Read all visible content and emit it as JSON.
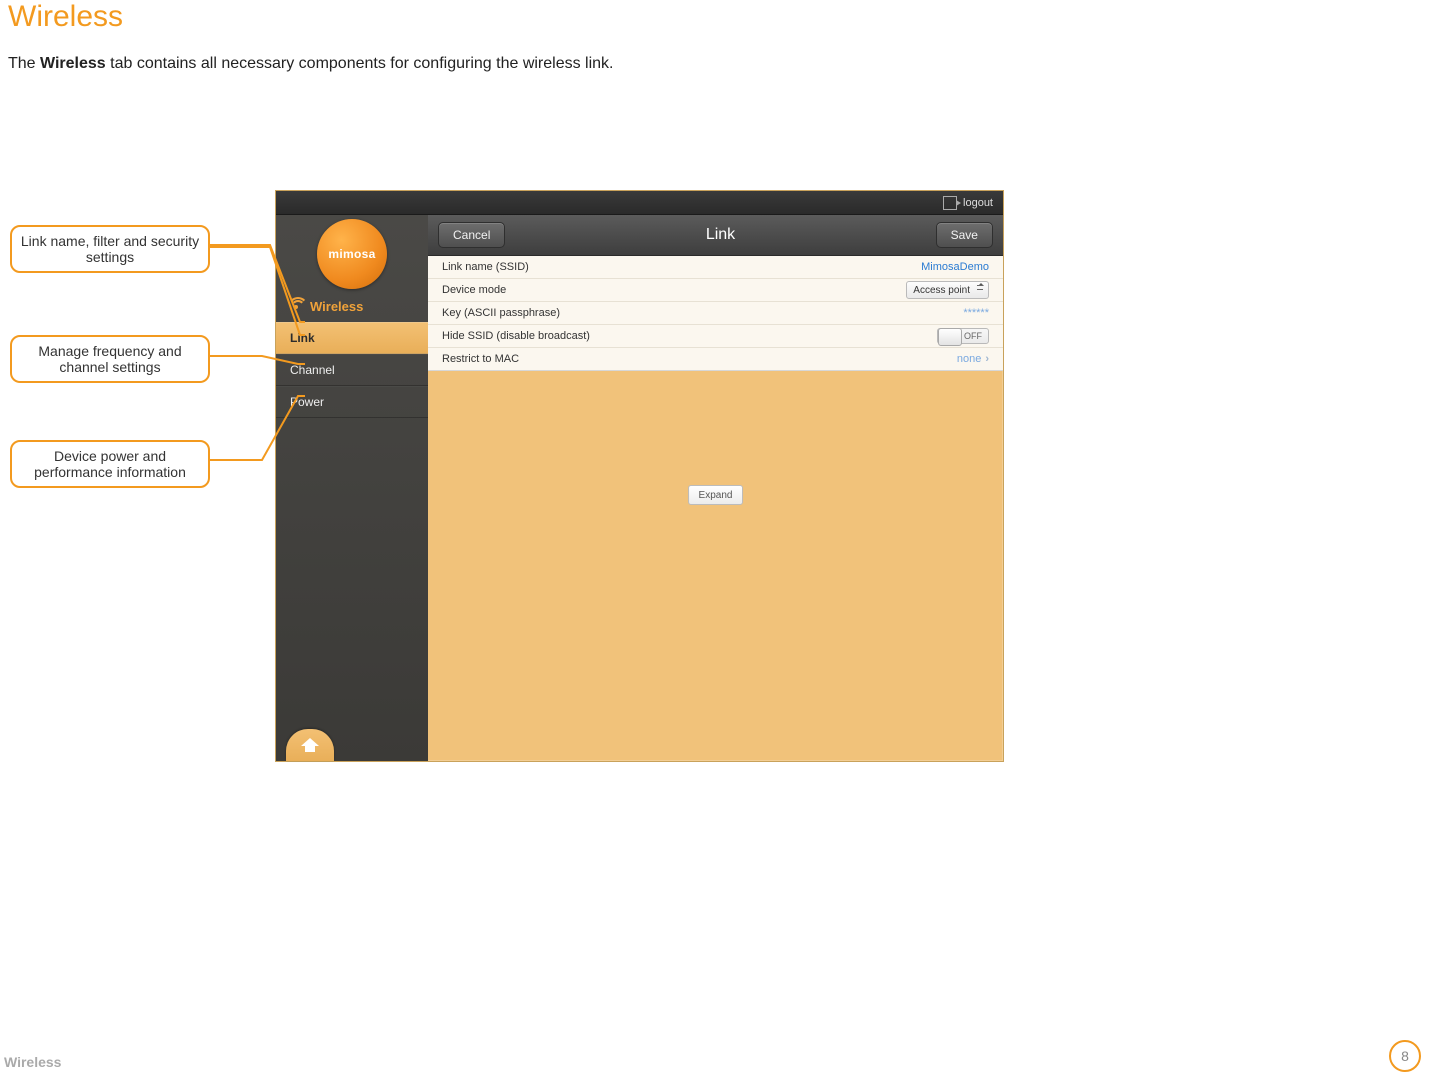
{
  "page": {
    "title": "Wireless",
    "intro_pre": "The ",
    "intro_bold": "Wireless",
    "intro_post": " tab contains all necessary components for configuring the wireless link."
  },
  "callouts": {
    "link": "Link name, filter and security settings",
    "channel": "Manage frequency and channel settings",
    "power": "Device power and performance information"
  },
  "app": {
    "topbar": {
      "logout": "logout"
    },
    "logo_text": "mimosa",
    "sidebar": {
      "section": "Wireless",
      "items": [
        {
          "label": "Link",
          "active": true
        },
        {
          "label": "Channel",
          "active": false
        },
        {
          "label": "Power",
          "active": false
        }
      ]
    },
    "panel": {
      "cancel": "Cancel",
      "title": "Link",
      "save": "Save",
      "rows": {
        "ssid_label": "Link name (SSID)",
        "ssid_value": "MimosaDemo",
        "mode_label": "Device mode",
        "mode_value": "Access point",
        "key_label": "Key (ASCII passphrase)",
        "key_value": "******",
        "hide_label": "Hide SSID (disable broadcast)",
        "hide_value": "OFF",
        "mac_label": "Restrict to MAC",
        "mac_value": "none"
      },
      "expand": "Expand"
    }
  },
  "footer": {
    "section": "Wireless",
    "page_number": "8"
  }
}
